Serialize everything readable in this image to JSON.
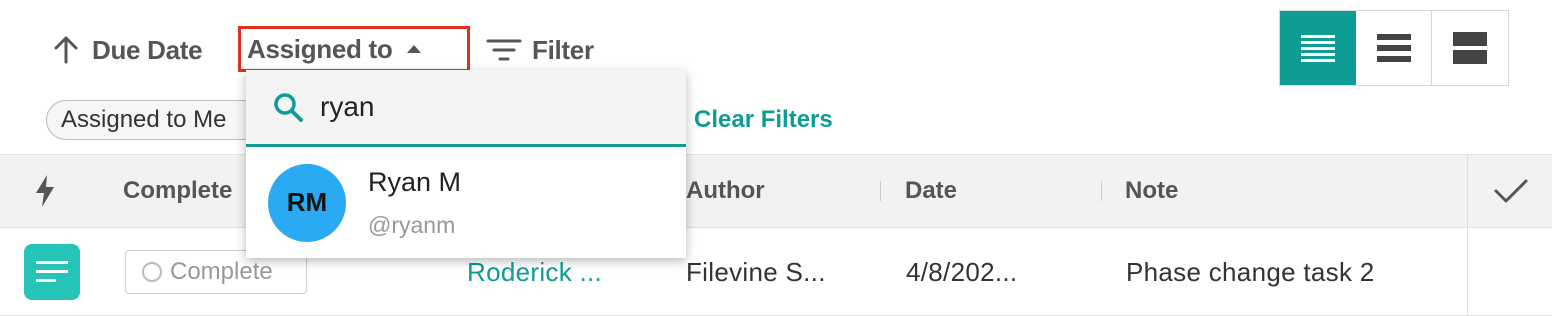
{
  "toolbar": {
    "sort_label": "Due Date",
    "assigned_label": "Assigned to",
    "filter_label": "Filter",
    "view_modes": [
      "compact-list",
      "list",
      "cards"
    ],
    "active_view": "compact-list"
  },
  "filters": {
    "chip_label": "Assigned to Me",
    "clear_label": "Clear Filters"
  },
  "dropdown": {
    "search_value": "ryan",
    "search_placeholder": "Search",
    "results": [
      {
        "initials": "RM",
        "name": "Ryan M",
        "handle": "@ryanm"
      }
    ]
  },
  "table": {
    "columns": {
      "complete": "Complete",
      "author": "Author",
      "date": "Date",
      "note": "Note"
    },
    "rows": [
      {
        "complete_label": "Complete",
        "assignee": "Roderick ...",
        "author": "Filevine S...",
        "date": "4/8/202...",
        "note": "Phase change task 2"
      }
    ]
  },
  "colors": {
    "accent": "#0e9c94",
    "highlight_border": "#e0301e",
    "avatar": "#2aaaf2",
    "task_icon": "#25c3b8"
  }
}
